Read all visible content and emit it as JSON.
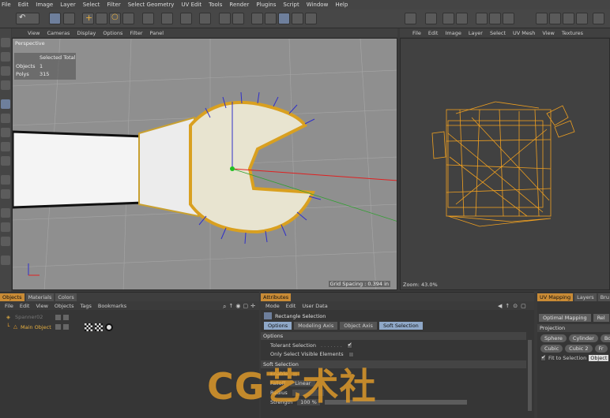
{
  "menubar": [
    "File",
    "Edit",
    "Image",
    "Layer",
    "Select",
    "Filter",
    "Select Geometry",
    "UV Edit",
    "Tools",
    "Render",
    "Plugins",
    "Script",
    "Window",
    "Help"
  ],
  "viewport": {
    "menu": [
      "View",
      "Cameras",
      "Display",
      "Options",
      "Filter",
      "Panel"
    ],
    "name": "Perspective",
    "hud_header": "Selected Total",
    "hud_objects_label": "Objects",
    "hud_objects_value": "1",
    "hud_polys_label": "Polys",
    "hud_polys_value": "315",
    "grid_spacing": "Grid Spacing : 0.394 in"
  },
  "uv_view": {
    "menu": [
      "File",
      "Edit",
      "Image",
      "Layer",
      "Select",
      "UV Mesh",
      "View",
      "Textures"
    ],
    "zoom": "Zoom: 43.0%"
  },
  "objects_panel": {
    "tabs": [
      "Objects",
      "Materials",
      "Colors"
    ],
    "menu": [
      "File",
      "Edit",
      "View",
      "Objects",
      "Tags",
      "Bookmarks"
    ],
    "items": [
      "Spanner02",
      "Main Object"
    ]
  },
  "attributes_panel": {
    "tab": "Attributes",
    "menu": [
      "Mode",
      "Edit",
      "User Data"
    ],
    "title": "Rectangle Selection",
    "subtabs": [
      "Options",
      "Modeling Axis",
      "Object Axis",
      "Soft Selection"
    ],
    "options_header": "Options",
    "tolerant_selection": "Tolerant Selection",
    "tolerant_dots": ". . . . . . .",
    "only_visible": "Only Select Visible Elements",
    "soft_header": "Soft Selection",
    "enable": "Enable",
    "falloff": "Falloff",
    "falloff_value": "Linear",
    "radius": "Radius",
    "strength": "Strength",
    "strength_value": "100 %"
  },
  "uv_mapping_panel": {
    "tabs": [
      "UV Mapping",
      "Layers",
      "Bru"
    ],
    "buttons_top": [
      "Optimal Mapping",
      "Rel"
    ],
    "projection_header": "Projection",
    "projection_buttons": [
      "Sphere",
      "Cylinder",
      "Box",
      "Cubic",
      "Cubic 2",
      "Fr"
    ],
    "fit_label": "Fit to Selection",
    "fit_value": "Object"
  },
  "watermark": "CG艺术社",
  "colors": {
    "accent": "#c98b35",
    "wire": "#f0a020",
    "grid_bg": "#9a9a9a"
  }
}
